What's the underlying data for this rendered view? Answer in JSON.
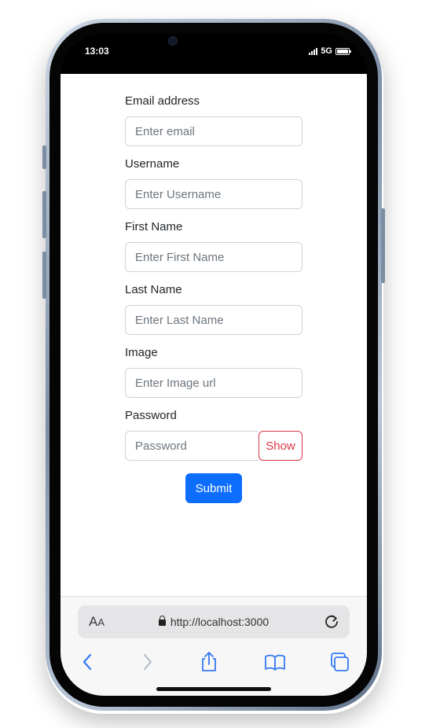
{
  "status_bar": {
    "time": "13:03",
    "network": "5G"
  },
  "form": {
    "email": {
      "label": "Email address",
      "placeholder": "Enter email"
    },
    "username": {
      "label": "Username",
      "placeholder": "Enter Username"
    },
    "first_name": {
      "label": "First Name",
      "placeholder": "Enter First Name"
    },
    "last_name": {
      "label": "Last Name",
      "placeholder": "Enter Last Name"
    },
    "image": {
      "label": "Image",
      "placeholder": "Enter Image url"
    },
    "password": {
      "label": "Password",
      "placeholder": "Password",
      "show_label": "Show"
    },
    "submit_label": "Submit"
  },
  "browser": {
    "aa_big": "A",
    "aa_small": "A",
    "url": "http://localhost:3000"
  },
  "colors": {
    "primary": "#0d6efd",
    "danger": "#dc3545",
    "system_blue": "#3478f6"
  }
}
